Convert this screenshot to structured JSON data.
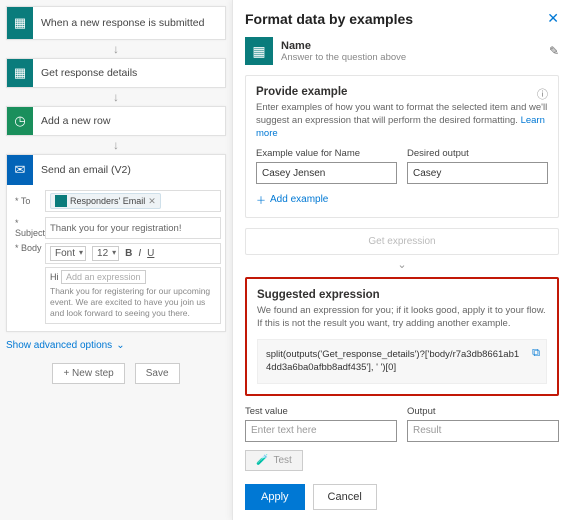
{
  "flow": {
    "steps": [
      {
        "title": "When a new response is submitted"
      },
      {
        "title": "Get response details"
      },
      {
        "title": "Add a new row"
      },
      {
        "title": "Send an email (V2)"
      }
    ],
    "email": {
      "to_label": "* To",
      "to_token": "Responders' Email",
      "subject_label": "* Subject",
      "subject_value": "Thank you for your registration!",
      "body_label": "* Body",
      "font_label": "Font",
      "font_size": "12",
      "hi": "Hi",
      "add_expr_placeholder": "Add an expression",
      "desc": "Thank you for registering for our upcoming event. We are excited to have you join us and look forward to seeing you there."
    },
    "advanced": "Show advanced options",
    "new_step": "+ New step",
    "save": "Save"
  },
  "panel": {
    "title": "Format data by examples",
    "name": {
      "label": "Name",
      "sub": "Answer to the question above"
    },
    "provide": {
      "title": "Provide example",
      "desc": "Enter examples of how you want to format the selected item and we'll suggest an expression that will perform the desired formatting.",
      "learn": "Learn more",
      "ex_label": "Example value for Name",
      "ex_value": "Casey Jensen",
      "out_label": "Desired output",
      "out_value": "Casey",
      "add": "Add example"
    },
    "get_expression": "Get expression",
    "sugg": {
      "title": "Suggested expression",
      "desc": "We found an expression for you; if it looks good, apply it to your flow. If this is not the result you want, try adding another example.",
      "code": "split(outputs('Get_response_details')?['body/r7a3db8661ab14dd3a6ba0afbb8adf435'], ' ')[0]"
    },
    "test": {
      "test_label": "Test value",
      "test_placeholder": "Enter text here",
      "out_label": "Output",
      "out_placeholder": "Result",
      "test_btn": "Test"
    },
    "apply": "Apply",
    "cancel": "Cancel"
  }
}
